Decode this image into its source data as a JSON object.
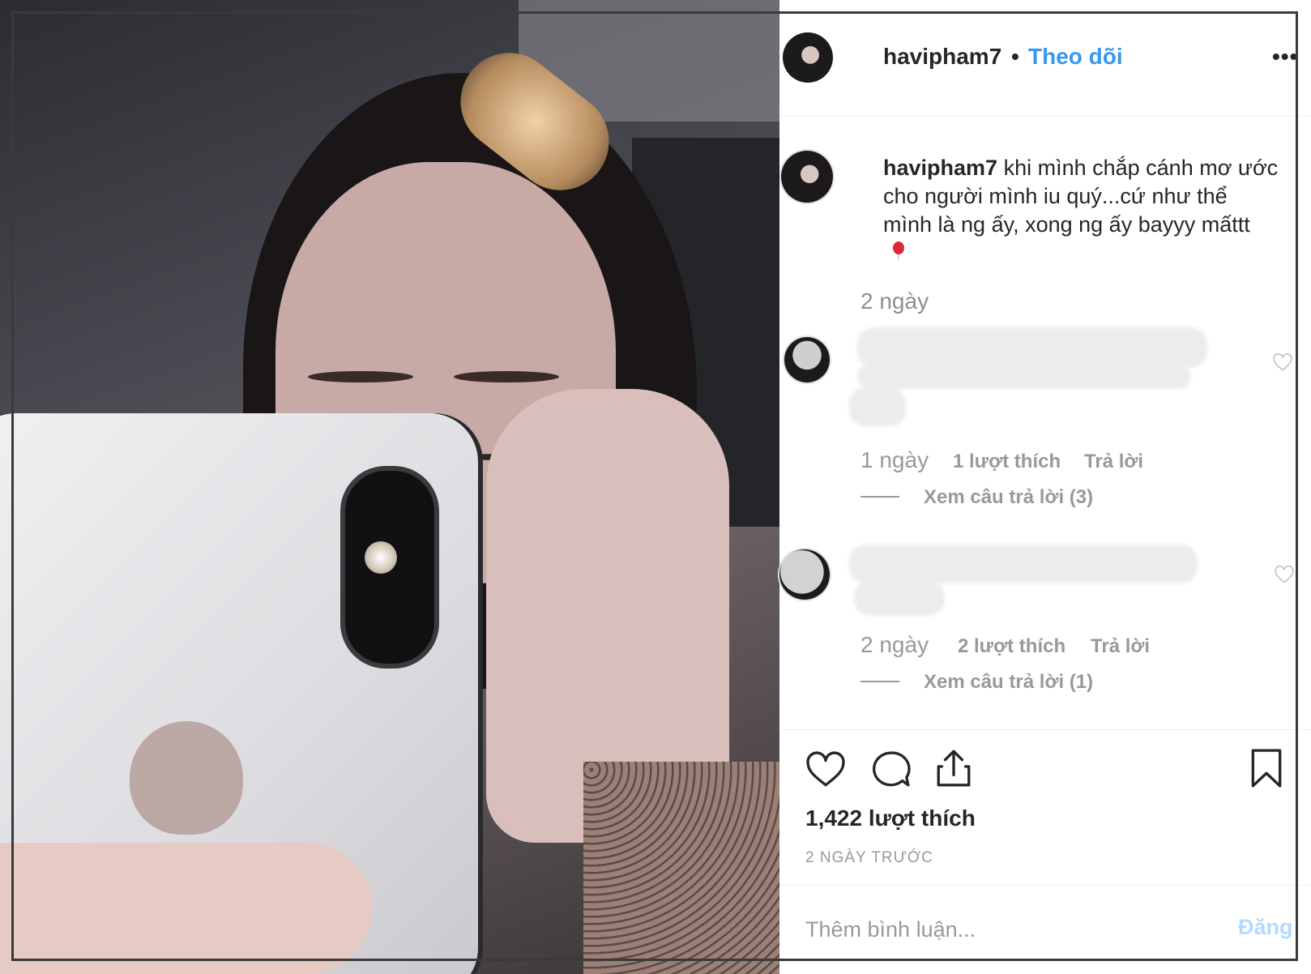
{
  "header": {
    "username": "havipham7",
    "separator": "•",
    "follow_label": "Theo dõi",
    "more_label": "•••"
  },
  "caption": {
    "username": "havipham7",
    "line1": " khi mình chắp cánh mơ ước",
    "line2": "cho người mình iu quý...cứ như thể",
    "line3": "mình là ng ấy, xong ng ấy bayyy mấttt",
    "emoji": "balloon-icon",
    "age": "2 ngày"
  },
  "comments": [
    {
      "time": "1 ngày",
      "likes": "1 lượt thích",
      "reply": "Trả lời",
      "view_replies": "Xem câu trả lời (3)"
    },
    {
      "time": "2 ngày",
      "likes": "2 lượt thích",
      "reply": "Trả lời",
      "view_replies": "Xem câu trả lời (1)"
    }
  ],
  "post": {
    "likes": "1,422 lượt thích",
    "posted": "2 NGÀY TRƯỚC"
  },
  "comment_form": {
    "placeholder": "Thêm bình luận...",
    "submit": "Đăng"
  },
  "colors": {
    "accent": "#3897f0",
    "muted": "#999999",
    "submit_disabled": "#b3dbff"
  }
}
